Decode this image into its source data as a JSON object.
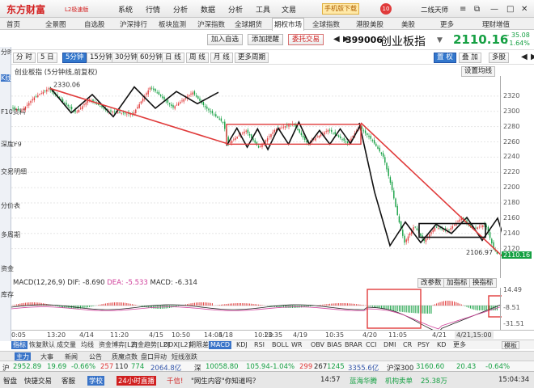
{
  "app": {
    "logo": "东方财富",
    "logo_sub": "L2极速版",
    "menus": [
      "系统",
      "行情",
      "分析",
      "数据",
      "分析",
      "工具",
      "文易",
      "帮助"
    ],
    "ad": "手机版下载",
    "notif_count": "10",
    "user": "二线天师"
  },
  "tabs": [
    "首页",
    "全景图",
    "自选股",
    "沪深排行",
    "板块监测",
    "沪深指数",
    "全球期货",
    "期权市场",
    "全球指数",
    "港股美股",
    "美股",
    "更多",
    "理财增值"
  ],
  "leftnav": [
    "分时图",
    "K线图",
    "F10资料",
    "深度F9",
    "交易明细",
    "分价表",
    "多周期",
    "资金",
    "库存"
  ],
  "toolbar": {
    "add": "加入自选",
    "alert": "添加提醒",
    "trade": "委托交易",
    "code": "399006",
    "name": "创业板指",
    "price": "2110.16",
    "change": "- 35.08",
    "pct": "- 1.64%",
    "btn1": "置 权",
    "btn2": "叠 加",
    "btn3": "多股"
  },
  "periods": [
    "分 时",
    "5 日",
    "5分钟",
    "15分钟",
    "30分钟",
    "60分钟",
    "日 线",
    "周 线",
    "月 线",
    "更多周期"
  ],
  "chart_title": "创业板指 (5分钟线,前复权)",
  "settings": "设置均线",
  "chart_data": {
    "type": "candlestick",
    "ylim": [
      2090,
      2340
    ],
    "yticks": [
      2320,
      2300,
      2280,
      2260,
      2240,
      2220,
      2200,
      2180,
      2160,
      2140,
      2120
    ],
    "high_label": "2330.06",
    "low_label": "2106.97",
    "current": "2110.16",
    "x_ticks": [
      "0:05",
      "13:20",
      "4/14",
      "11:20",
      "4/15",
      "10:50",
      "14:05",
      "4/18",
      "10:20",
      "13:35",
      "4/19",
      "10:35",
      "4/20",
      "11:05",
      "4/21",
      "15:00"
    ],
    "zigzag_1": [
      2331,
      2298,
      2322,
      2293,
      2332,
      2304,
      2326,
      2310,
      2325
    ],
    "zigzag_2": [
      2255,
      2278,
      2253,
      2277,
      2250,
      2278,
      2257,
      2286,
      2257,
      2275,
      2257,
      2277,
      2258,
      2283
    ],
    "zigzag_3": [
      2285,
      2194,
      2124,
      2155,
      2128,
      2152,
      2140,
      2161,
      2131,
      2160,
      2097
    ],
    "trend_line": [
      [
        2330,
        2258
      ],
      [
        2285,
        2097
      ]
    ],
    "box_1": [
      2283,
      2257
    ],
    "box_2": [
      2153,
      2135
    ]
  },
  "macd": {
    "label": "MACD(12,26,9)",
    "dif_label": "DIF:",
    "dif": "-8.690",
    "dea_label": "DEA:",
    "dea": "-5.533",
    "macd_label": "MACD:",
    "macd": "-6.314",
    "btns": [
      "改参数",
      "加指标",
      "换指标"
    ],
    "yticks": [
      "14.49",
      "-8.51",
      "-31.51"
    ]
  },
  "x_right": "4/21,15:00",
  "indicators": [
    "指标",
    "恢复默认",
    "成交量",
    "均线",
    "资金博弈[L2]",
    "资金趋势[L2]",
    "DDX[L2]",
    "期限差",
    "MACD",
    "KDJ",
    "RSI",
    "BOLL",
    "WR",
    "OBV",
    "BIAS",
    "BRAR",
    "CCI",
    "DMI",
    "CR",
    "PSY",
    "KD",
    "更多"
  ],
  "ind_extra": "模板",
  "funcs": [
    "主力",
    "大事",
    "新闻",
    "公告",
    "质魔点数",
    "盘口异动",
    "短线涨跌"
  ],
  "market": {
    "i1": "沪",
    "v1": "2952.89",
    "c1": "19.69",
    "p1": "-0.66%",
    "u1": "257",
    "f1": "110",
    "d1": "774",
    "a1": "2064.8亿",
    "i2": "深",
    "v2": "10058.80",
    "c2": "105.94",
    "p2": "-1.04%",
    "u2": "299",
    "f2": "267",
    "d2": "1245",
    "a2": "3355.6亿",
    "i3": "沪深300",
    "v3": "3160.60",
    "c3": "20.43",
    "p3": "-0.64%"
  },
  "status": {
    "s1": "智盘",
    "s2": "快捷交易",
    "s3": "客服",
    "s4": "学校",
    "s5": "24小时直播",
    "s6": "千信!",
    "s7": "\"网生内容\"你知道吗？",
    "s8": "14:57",
    "s9": "蓝海华腾",
    "s10": "机构卖单",
    "s11": "25.38万",
    "time": "15:04:34"
  },
  "colors": {
    "up": "#e03b3b",
    "down": "#16a043",
    "accent": "#3a74c8"
  }
}
